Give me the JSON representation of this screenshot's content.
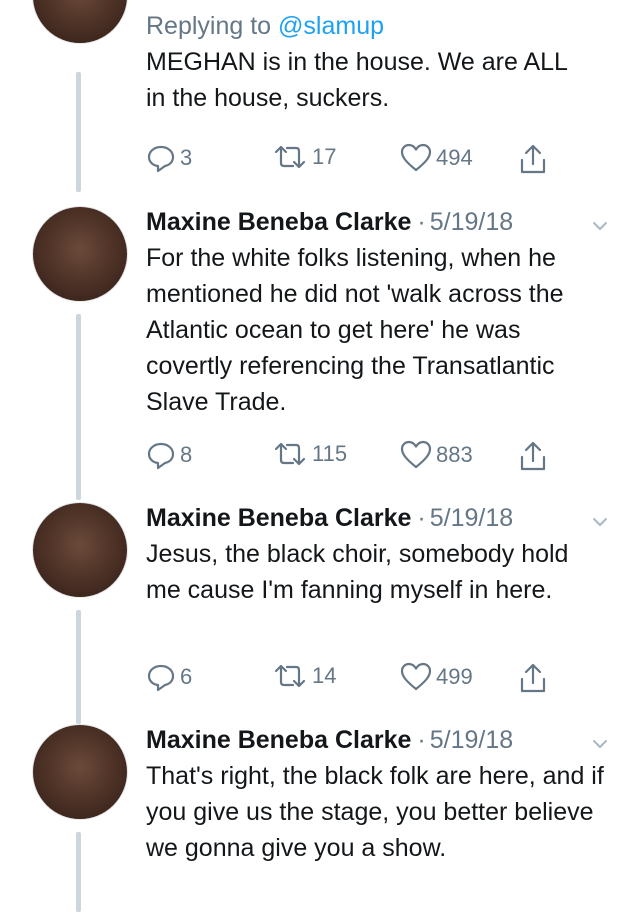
{
  "tweets": [
    {
      "replying_prefix": "Replying to",
      "replying_handle": "@slamup",
      "text": "MEGHAN is in the house. We are ALL in the house, suckers.",
      "replies": "3",
      "retweets": "17",
      "likes": "494"
    },
    {
      "name": "Maxine Beneba Clarke",
      "date": "5/19/18",
      "text": "For the white folks listening, when he mentioned he did not 'walk across the Atlantic ocean to get here' he was covertly referencing the Transatlantic Slave Trade.",
      "replies": "8",
      "retweets": "115",
      "likes": "883"
    },
    {
      "name": "Maxine Beneba Clarke",
      "date": "5/19/18",
      "text": "Jesus, the black choir, somebody hold me cause I'm fanning myself in here.",
      "replies": "6",
      "retweets": "14",
      "likes": "499"
    },
    {
      "name": "Maxine Beneba Clarke",
      "date": "5/19/18",
      "text": "That's right, the black folk are here, and if you give us the stage, you better believe we gonna give you a show."
    }
  ],
  "icons": {
    "reply": "reply-icon",
    "retweet": "retweet-icon",
    "like": "heart-icon",
    "share": "share-icon",
    "caret": "chevron-down-icon"
  },
  "colors": {
    "text": "#14171a",
    "muted": "#657786",
    "link": "#1da1f2",
    "thread_line": "#ccd6dd"
  }
}
